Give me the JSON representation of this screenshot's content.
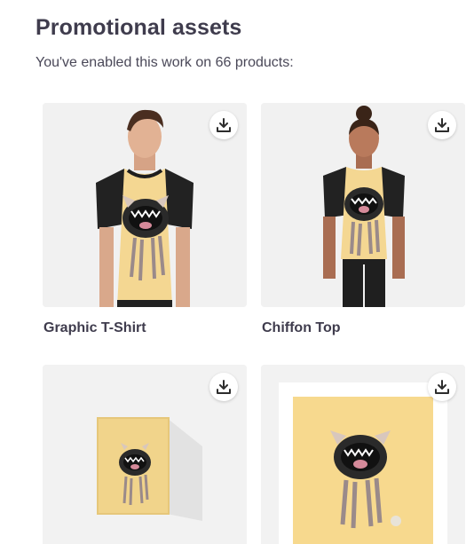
{
  "section": {
    "title": "Promotional assets",
    "subtitle": "You've enabled this work on 66 products:"
  },
  "products": [
    {
      "name": "Graphic T-Shirt",
      "icon": "download-icon"
    },
    {
      "name": "Chiffon Top",
      "icon": "download-icon"
    },
    {
      "name": "",
      "icon": "download-icon"
    },
    {
      "name": "",
      "icon": "download-icon"
    }
  ],
  "colors": {
    "heading": "#3f3c4d",
    "artwork_yellow": "#f6d98c",
    "card_bg": "#f2f2f2"
  }
}
